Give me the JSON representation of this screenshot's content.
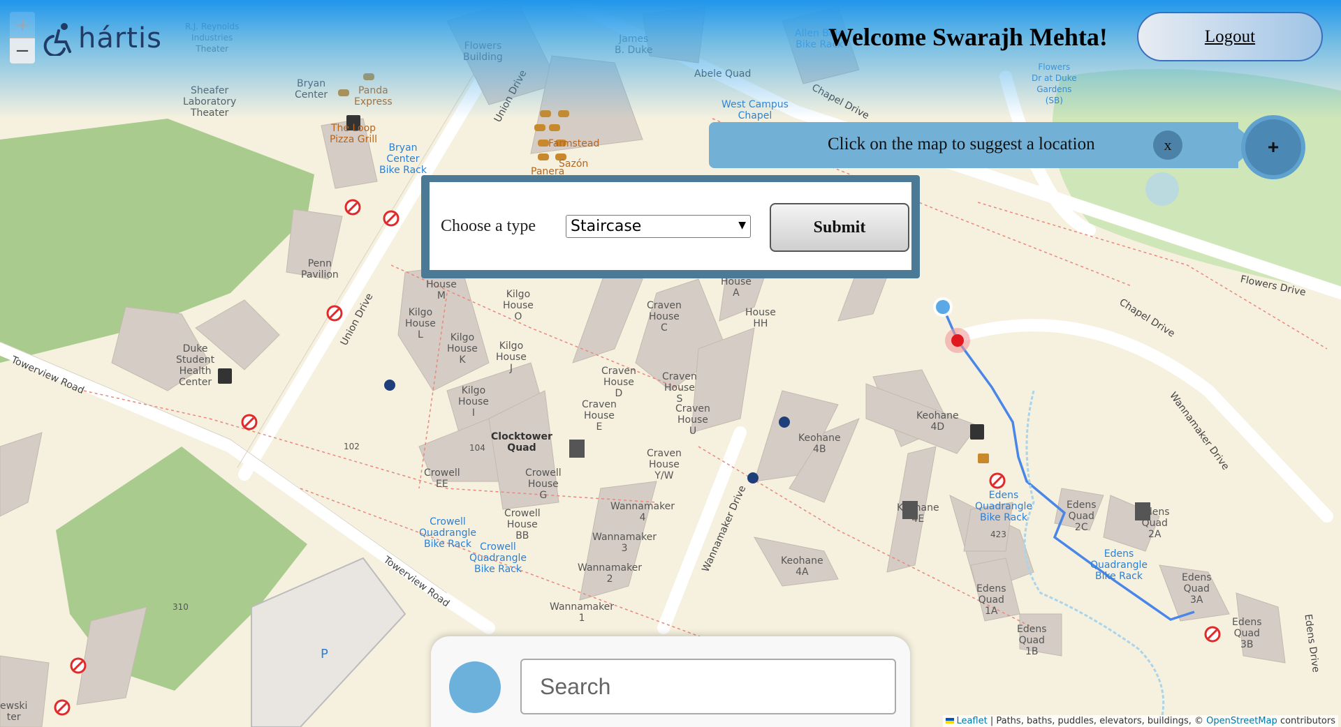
{
  "app": {
    "logo_text": "hártis"
  },
  "zoom": {
    "in_label": "+",
    "out_label": "−"
  },
  "header": {
    "welcome": "Welcome Swarajh Mehta!",
    "logout_label": "Logout"
  },
  "suggest": {
    "text": "Click on the map to suggest a location",
    "close_label": "x",
    "add_label": "+"
  },
  "type_panel": {
    "label": "Choose a type",
    "selected": "Staircase",
    "submit_label": "Submit"
  },
  "search": {
    "placeholder": "Search"
  },
  "attribution": {
    "leaflet": "Leaflet",
    "middle": " | Paths, baths, puddles, elevators, buildings, © ",
    "osm": "OpenStreetMap",
    "end": " contributors"
  },
  "map_labels": {
    "reynolds": "R.J. Reynolds\nIndustries\nTheater",
    "sheafer": "Sheafer\nLaboratory\nTheater",
    "bryan": "Bryan\nCenter",
    "panda": "Panda\nExpress",
    "loop": "The Loop\nPizza Grill",
    "bryan_rack": "Bryan\nCenter\nBike Rack",
    "flowers_bldg": "Flowers\nBuilding",
    "james_duke": "James\nB. Duke",
    "abele": "Abele Quad",
    "wc_chapel": "West Campus\nChapel",
    "farmstead": "Farmstead",
    "sazon": "Sazón",
    "panera": "Panera",
    "union_dr1": "Union Drive",
    "union_dr2": "Union Drive",
    "chapel_dr1": "Chapel Drive",
    "chapel_dr2": "Chapel Drive",
    "flowers_dr": "Flowers Drive",
    "allen": "Allen Bldg\nBike Rack",
    "gardens": "Flowers\nDr at Duke\nGardens\n(SB)",
    "penn": "Penn\nPavilion",
    "dshc": "Duke\nStudent\nHealth\nCenter",
    "towerview1": "Towerview Road",
    "towerview2": "Towerview Road",
    "house_m": "House\nM",
    "kilgo_house_l": "Kilgo\nHouse\nL",
    "kilgo_house_o": "Kilgo\nHouse\nO",
    "kilgo_house_k": "Kilgo\nHouse\nK",
    "kilgo_house_j": "Kilgo\nHouse\nJ",
    "kilgo_house_i": "Kilgo\nHouse\nI",
    "house_a": "House\nA",
    "craven_c": "Craven\nHouse\nC",
    "house_hh": "House\nHH",
    "craven_d": "Craven\nHouse\nD",
    "craven_s": "Craven\nHouse\nS",
    "craven_e": "Craven\nHouse\nE",
    "craven_u": "Craven\nHouse\nU",
    "craven_yw": "Craven\nHouse\nY/W",
    "clocktower": "Clocktower\nQuad",
    "n104": "104",
    "n102": "102",
    "n310": "310",
    "n423": "423",
    "crowell_ee": "Crowell\nEE",
    "crowell_g": "Crowell\nHouse\nG",
    "crowell_bb": "Crowell\nHouse\nBB",
    "crowell_rack1": "Crowell\nQuadrangle\nBike Rack",
    "crowell_rack2": "Crowell\nQuadrangle\nBike Rack",
    "wm4": "Wannamaker\n4",
    "wm3": "Wannamaker\n3",
    "wm2": "Wannamaker\n2",
    "wm1": "Wannamaker\n1",
    "wm_drive1": "Wannamaker Drive",
    "wm_drive2": "Wannamaker Drive",
    "keohane_4d": "Keohane\n4D",
    "keohane_4b": "Keohane\n4B",
    "keohane_4e": "Keohane\n4E",
    "keohane_4a": "Keohane\n4A",
    "edens_rack1": "Edens\nQuadrangle\nBike Rack",
    "edens_2c": "Edens\nQuad\n2C",
    "edens_2a": "Edens\nQuad\n2A",
    "edens_rack2": "Edens\nQuadrangle\nBike Rack",
    "edens_1a": "Edens\nQuad\n1A",
    "edens_1b": "Edens\nQuad\n1B",
    "edens_3a": "Edens\nQuad\n3A",
    "edens_3b": "Edens\nQuad\n3B",
    "edens_drive": "Edens Drive",
    "ewski": "ewski\nter",
    "parking": "P"
  }
}
